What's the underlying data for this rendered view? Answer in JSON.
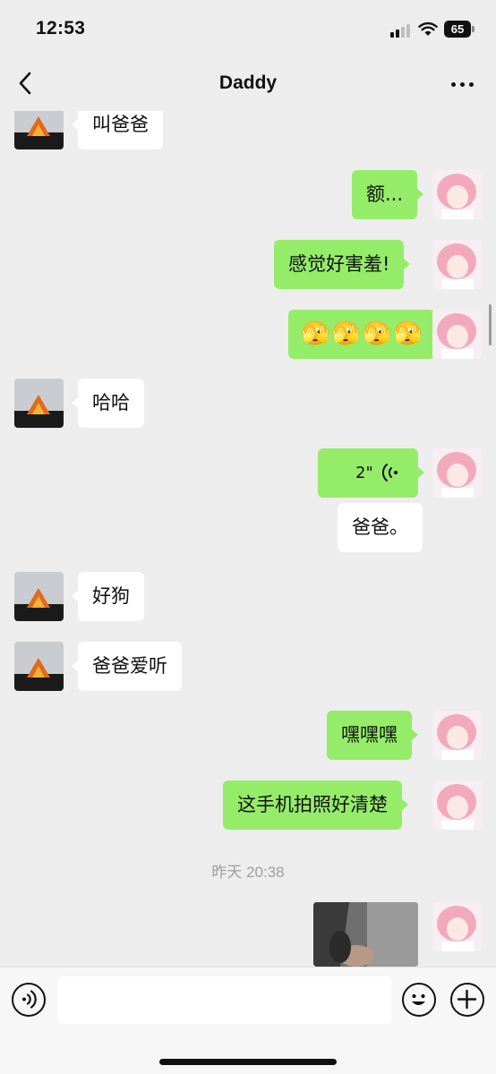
{
  "status_bar": {
    "time": "12:53",
    "battery": "65"
  },
  "nav": {
    "title": "Daddy",
    "back_icon": "chevron-left-icon",
    "more_icon": "more-dots-icon"
  },
  "messages": [
    {
      "side": "in",
      "type": "text",
      "text": "叫爸爸"
    },
    {
      "side": "out",
      "type": "text",
      "text": "额..."
    },
    {
      "side": "out",
      "type": "text",
      "text": "感觉好害羞!"
    },
    {
      "side": "out",
      "type": "emoji",
      "emoji": [
        "🫣",
        "🫣",
        "🫣",
        "🫣"
      ]
    },
    {
      "side": "in",
      "type": "text",
      "text": "哈哈"
    },
    {
      "side": "out",
      "type": "voice",
      "duration": "2\""
    },
    {
      "side": "out",
      "type": "transcript",
      "text": "爸爸。"
    },
    {
      "side": "in",
      "type": "text",
      "text": "好狗"
    },
    {
      "side": "in",
      "type": "text",
      "text": "爸爸爱听"
    },
    {
      "side": "out",
      "type": "text",
      "text": "嘿嘿嘿"
    },
    {
      "side": "out",
      "type": "text",
      "text": "这手机拍照好清楚"
    },
    {
      "side": "out",
      "type": "image",
      "icon": "photo-thumbnail"
    }
  ],
  "timestamp": "昨天 20:38",
  "input_bar": {
    "voice_icon": "voice-toggle-icon",
    "message_value": "",
    "emoji_icon": "smiley-icon",
    "plus_icon": "plus-icon"
  },
  "colors": {
    "background": "#ededed",
    "bubble_out": "#95ec69",
    "bubble_in": "#ffffff"
  }
}
